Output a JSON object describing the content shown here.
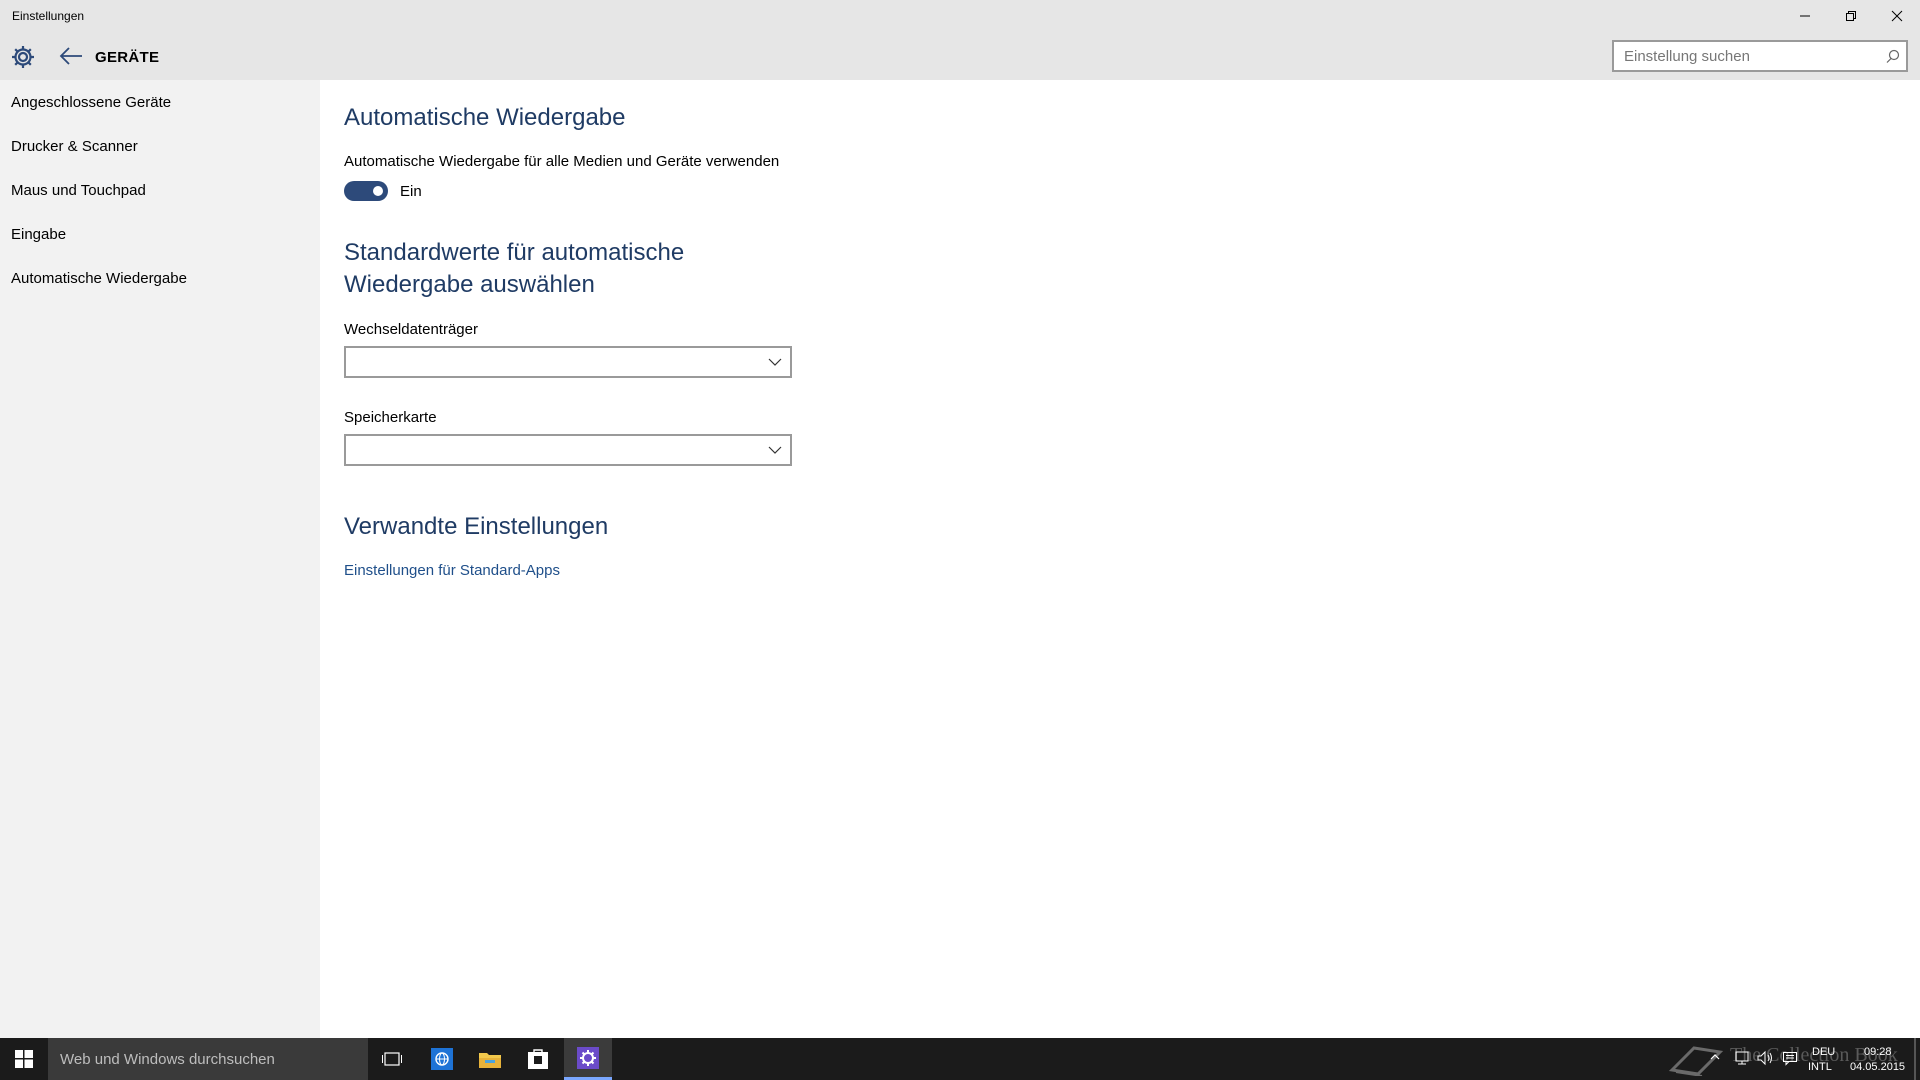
{
  "window": {
    "title": "Einstellungen"
  },
  "header": {
    "section_title": "GERÄTE",
    "search_placeholder": "Einstellung suchen"
  },
  "sidebar": {
    "items": [
      {
        "label": "Angeschlossene Geräte"
      },
      {
        "label": "Drucker & Scanner"
      },
      {
        "label": "Maus und Touchpad"
      },
      {
        "label": "Eingabe"
      },
      {
        "label": "Automatische Wiedergabe"
      }
    ]
  },
  "main": {
    "heading": "Automatische Wiedergabe",
    "toggle_label": "Automatische Wiedergabe für alle Medien und Geräte verwenden",
    "toggle_state_text": "Ein",
    "toggle_on": true,
    "defaults_heading_line1": "Standardwerte für automatische",
    "defaults_heading_line2": "Wiedergabe auswählen",
    "removable_label": "Wechseldatenträger",
    "removable_value": "",
    "memcard_label": "Speicherkarte",
    "memcard_value": "",
    "related_heading": "Verwandte Einstellungen",
    "related_link": "Einstellungen für Standard-Apps"
  },
  "taskbar": {
    "search_placeholder": "Web und Windows durchsuchen",
    "watermark": "The Collection Book",
    "lang_top": "DEU",
    "lang_bottom": "INTL",
    "time": "09:28",
    "date": "04.05.2015"
  },
  "colors": {
    "accent": "#2d4a7a",
    "heading": "#1f3b64",
    "link": "#1f4f8a",
    "chrome": "#e6e6e6",
    "sidebar": "#f2f2f2",
    "taskbar": "#1b1b1b"
  }
}
